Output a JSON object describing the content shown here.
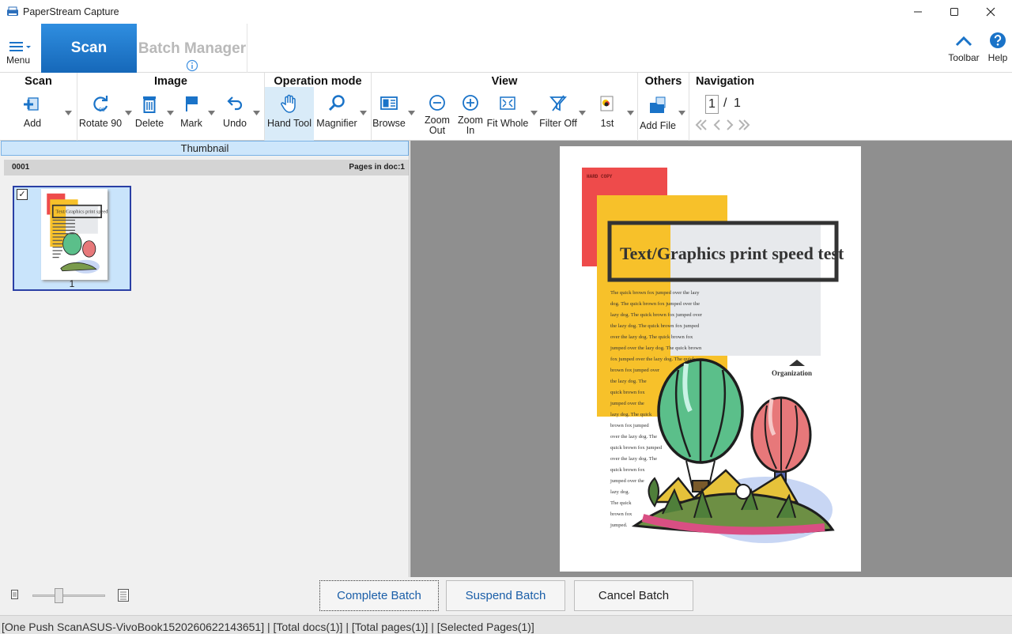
{
  "window": {
    "title": "PaperStream Capture",
    "controls": {
      "minimize": "minimize-icon",
      "maximize": "maximize-icon",
      "close": "close-icon"
    }
  },
  "tabs": {
    "menu_label": "Menu",
    "scan_label": "Scan",
    "batch_manager_label": "Batch Manager",
    "toolbar_label": "Toolbar",
    "help_label": "Help"
  },
  "ribbon": {
    "groups": {
      "scan": "Scan",
      "image": "Image",
      "operation_mode": "Operation mode",
      "view": "View",
      "others": "Others",
      "navigation": "Navigation"
    },
    "buttons": {
      "add": "Add",
      "rotate": "Rotate 90",
      "rotate_badge": "90",
      "delete": "Delete",
      "mark": "Mark",
      "undo": "Undo",
      "hand_tool": "Hand Tool",
      "magnifier": "Magnifier",
      "browse": "Browse",
      "zoom_out": "Zoom\nOut",
      "zoom_in": "Zoom\nIn",
      "fit_whole": "Fit Whole",
      "filter_off": "Filter Off",
      "first": "1st",
      "add_file": "Add File"
    },
    "navigation": {
      "current_page": "1",
      "separator": "/",
      "total_pages": "1"
    }
  },
  "thumbnail_pane": {
    "header": "Thumbnail",
    "doc_id": "0001",
    "pages_in_doc": "Pages in doc:1",
    "items": [
      {
        "page_number": "1",
        "checked": true
      }
    ]
  },
  "document_page": {
    "hard_copy": "HARD COPY",
    "heading": "Text/Graphics print speed test",
    "organization": "Organization",
    "body_lines": [
      "The quick brown fox jumped over the lazy",
      "dog. The quick brown fox jumped over the",
      "lazy dog. The quick brown fox jumped over",
      "the lazy dog. The quick brown fox jumped",
      "over the lazy dog. The quick brown fox",
      "jumped over the lazy dog. The quick brown",
      "fox jumped over the lazy dog. The quick",
      "brown fox jumped over",
      "the lazy dog. The",
      "quick brown fox",
      "jumped over the",
      "lazy dog. The quick",
      "brown fox jumped",
      "over the lazy dog. The",
      "quick brown fox jumped",
      "over the lazy dog. The",
      "quick brown fox",
      "jumped over the",
      "lazy dog.",
      "The quick",
      "brown fox",
      "jumped."
    ],
    "colors": {
      "red": "#ee4b4b",
      "yellow": "#f7c12a",
      "gray_box": "#e7e9ec",
      "cloud": "#c8d6f4"
    }
  },
  "bottom_bar": {
    "complete_batch": "Complete Batch",
    "suspend_batch": "Suspend Batch",
    "cancel_batch": "Cancel Batch",
    "zoom_slider_level": 0.35
  },
  "status_bar": {
    "text": "[One Push ScanASUS-VivoBook1520260622143651] | [Total docs(1)] | [Total pages(1)] | [Selected Pages(1)]"
  },
  "colors": {
    "accent": "#1a73c8",
    "scan_tab": "#1f7cd0",
    "batch_text_disabled": "#b9b9b9",
    "selection": "#2a3fa5"
  }
}
